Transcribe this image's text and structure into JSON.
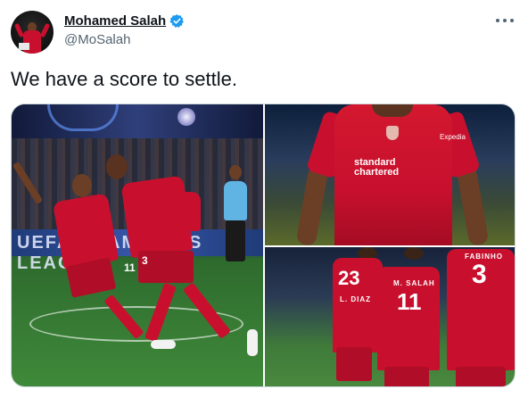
{
  "user": {
    "display_name": "Mohamed Salah",
    "handle": "@MoSalah"
  },
  "tweet": {
    "text": "We have a score to settle."
  },
  "photos": {
    "photo1": {
      "banner_text": "UEFA  CHAMPIONS LEAGUE",
      "players": [
        {
          "number": "11"
        },
        {
          "number": "3"
        }
      ]
    },
    "photo2": {
      "sponsor": "standard\nchartered",
      "sleeve_sponsor": "Expedia"
    },
    "photo3": {
      "players": [
        {
          "number": "23",
          "name": "L. DIAZ"
        },
        {
          "number": "11",
          "name": "M. SALAH"
        },
        {
          "number": "3",
          "name": "FABINHO"
        }
      ]
    }
  },
  "colors": {
    "verified": "#1d9bf0",
    "liverpool_red": "#c8102e"
  },
  "icons": {
    "verified": "verified-badge-icon",
    "more": "more-horizontal-icon"
  }
}
